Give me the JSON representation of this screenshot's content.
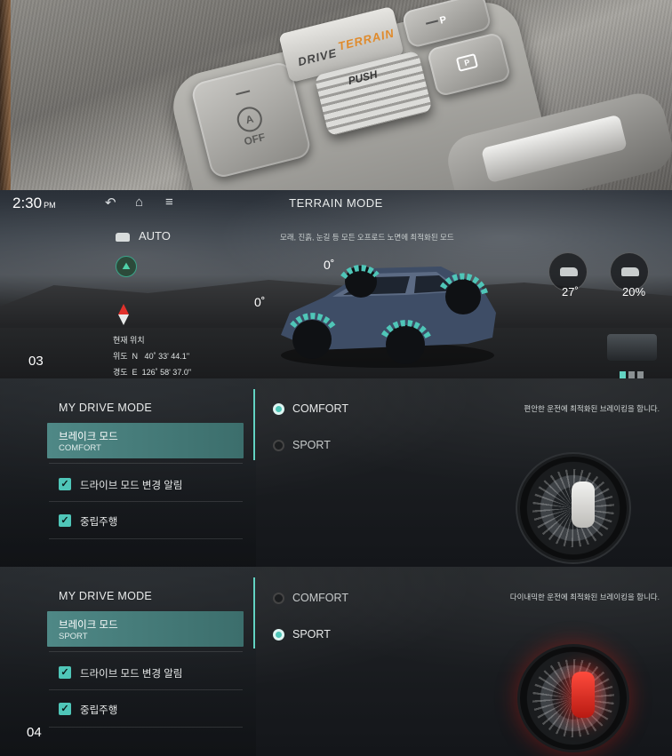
{
  "console": {
    "terrain_dial_left": "DRIVE",
    "terrain_dial_right": "TERRAIN",
    "push_label": "PUSH",
    "off_button_label": "OFF",
    "off_button_symbol": "A",
    "phold_label": "P",
    "park_label": "P",
    "icons": [
      "auto-hold-off-icon",
      "parking-brake-icon",
      "p-hold-icon"
    ]
  },
  "terrain_screen": {
    "clock_time": "2:30",
    "clock_ampm": "PM",
    "title": "TERRAIN MODE",
    "mode": "AUTO",
    "description": "모래, 진흙, 눈길 등 모든 오프로드 노면에 최적화된 모드",
    "position_label": "현재 위치",
    "latitude_label": "위도  N   40˚ 33' 44.1\"",
    "longitude_label": "경도  E  126˚ 58' 37.0\"",
    "front_angle": "0˚",
    "side_angle": "0˚",
    "pitch": "27˚",
    "slope": "20%",
    "figure_number": "03",
    "accent_color": "#4fc6b8",
    "icons": [
      "back-icon",
      "home-icon",
      "menu-icon",
      "car-icon",
      "grade-icon",
      "compass-icon"
    ]
  },
  "comfort_panel": {
    "section_title": "MY DRIVE MODE",
    "brake_item_title": "브레이크 모드",
    "brake_item_value": "COMFORT",
    "checkbox_1": "드라이브 모드 변경 알림",
    "checkbox_2": "중립주행",
    "option_comfort": "COMFORT",
    "option_sport": "SPORT",
    "selected": "COMFORT",
    "description": "편안한 운전에 최적화된 브레이킹을 합니다."
  },
  "sport_panel": {
    "section_title": "MY DRIVE MODE",
    "brake_item_title": "브레이크 모드",
    "brake_item_value": "SPORT",
    "checkbox_1": "드라이브 모드 변경 알림",
    "checkbox_2": "중립주행",
    "option_comfort": "COMFORT",
    "option_sport": "SPORT",
    "selected": "SPORT",
    "description": "다이내믹한 운전에 최적화된 브레이킹을 합니다.",
    "figure_number": "04",
    "caliper_color": "#e8281e"
  }
}
